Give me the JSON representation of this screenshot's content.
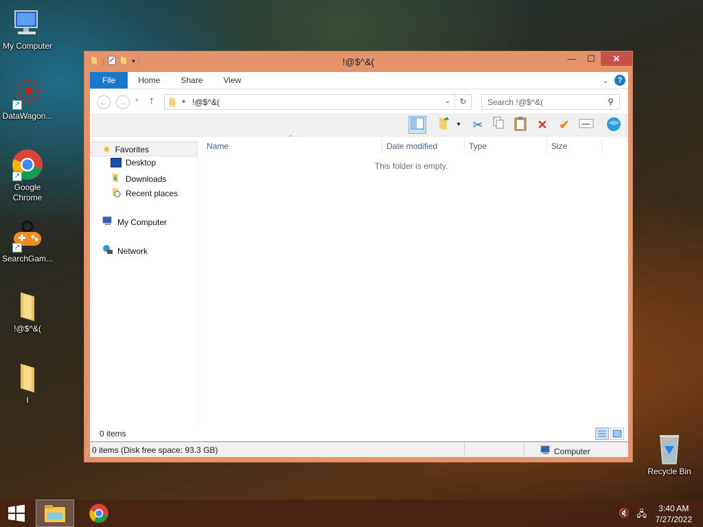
{
  "desktop": {
    "icons": [
      {
        "label": "My Computer"
      },
      {
        "label": "DataWagon..."
      },
      {
        "label": "Google Chrome"
      },
      {
        "label": "SearchGam..."
      },
      {
        "label": "!@$^&("
      },
      {
        "label": "I"
      },
      {
        "label": "Recycle Bin"
      }
    ]
  },
  "window": {
    "title": "!@$^&(",
    "tabs": [
      {
        "label": "File"
      },
      {
        "label": "Home"
      },
      {
        "label": "Share"
      },
      {
        "label": "View"
      }
    ],
    "address": "!@$^&(",
    "search_placeholder": "Search !@$^&(",
    "nav": {
      "favorites": "Favorites",
      "desktop": "Desktop",
      "downloads": "Downloads",
      "recent": "Recent places",
      "computer": "My Computer",
      "network": "Network"
    },
    "columns": [
      {
        "label": "Name"
      },
      {
        "label": "Date modified"
      },
      {
        "label": "Type"
      },
      {
        "label": "Size"
      }
    ],
    "empty_text": "This folder is empty.",
    "items_count": "0 items",
    "status_left": "0 items (Disk free space: 93.3 GB)",
    "status_right": "Computer"
  },
  "taskbar": {
    "time": "3:40 AM",
    "date": "7/27/2022"
  },
  "colors": {
    "window_frame": "#e4936a",
    "close_button": "#c7504a",
    "file_tab": "#1979ca"
  }
}
